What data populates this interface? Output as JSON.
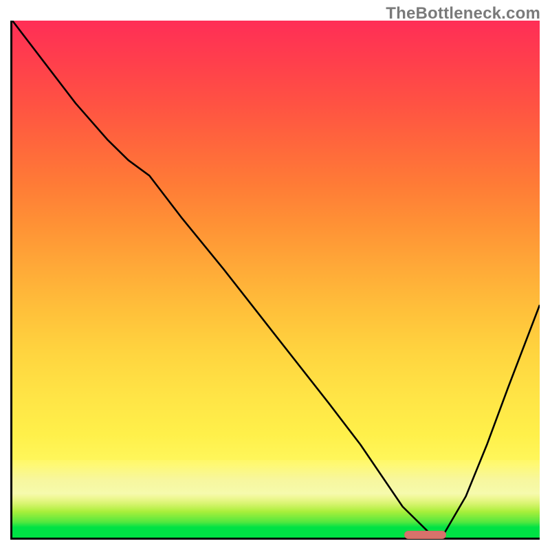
{
  "watermark": "TheBottleneck.com",
  "colors": {
    "axis": "#000000",
    "curve": "#000000",
    "marker": "#d9726b",
    "gradient_top": "#ff2e56",
    "gradient_bottom": "#00e245"
  },
  "chart_data": {
    "type": "line",
    "title": "",
    "xlabel": "",
    "ylabel": "",
    "xlim": [
      0,
      100
    ],
    "ylim": [
      0,
      100
    ],
    "grid": false,
    "legend": false,
    "x": [
      0,
      6,
      12,
      18,
      22,
      26,
      32,
      40,
      50,
      60,
      66,
      70,
      74,
      79,
      82,
      86,
      90,
      94,
      100
    ],
    "values": [
      100,
      92,
      84,
      77,
      73,
      70,
      62,
      52,
      39,
      26,
      18,
      12,
      6,
      1,
      1,
      8,
      18,
      29,
      45
    ],
    "highlight_range_x": [
      74,
      82
    ],
    "highlight_y": 1
  }
}
